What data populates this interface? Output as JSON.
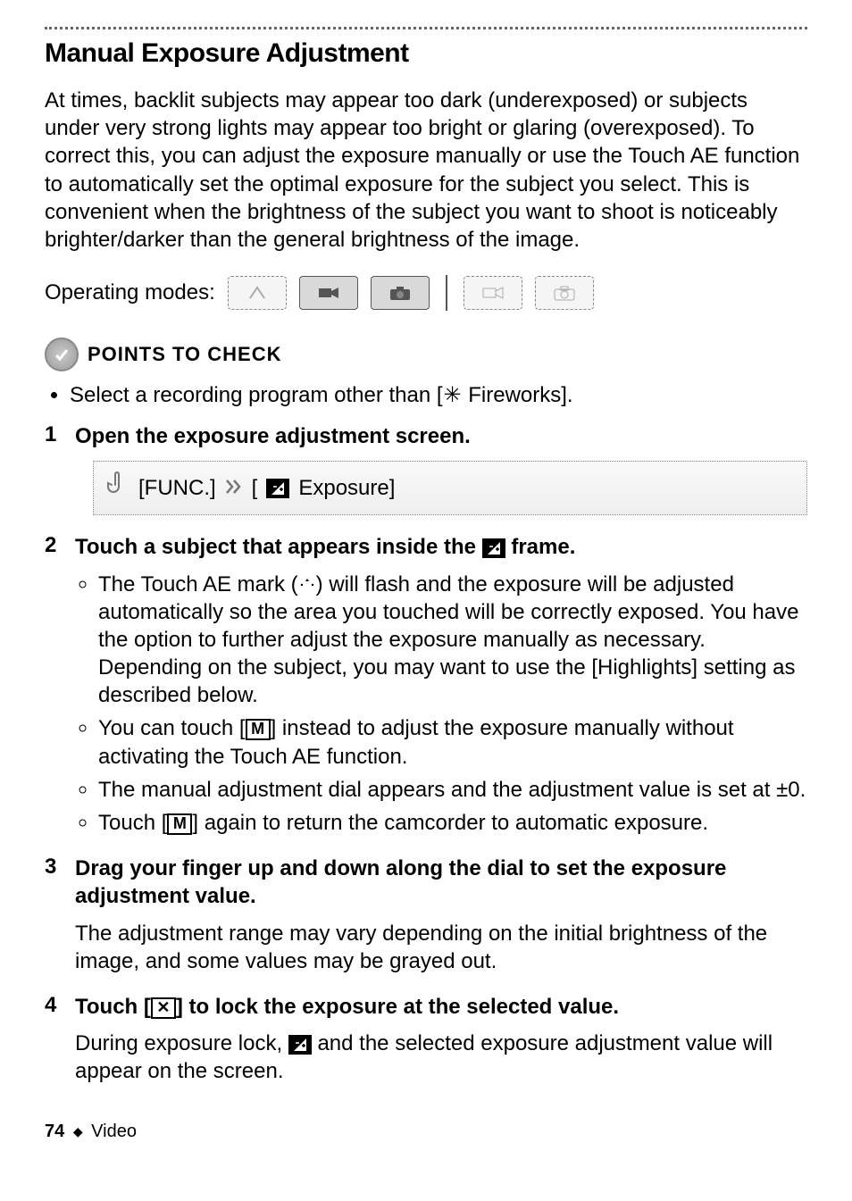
{
  "title": "Manual Exposure Adjustment",
  "intro": "At times, backlit subjects may appear too dark (underexposed) or subjects under very strong lights may appear too bright or glaring (overexposed). To correct this, you can adjust the exposure manually or use the Touch AE function to automatically set the optimal exposure for the subject you select. This is convenient when the brightness of the subject you want to shoot is noticeably brighter/darker than the general brightness of the image.",
  "operating_modes_label": "Operating modes:",
  "points_to_check_label": "POINTS TO CHECK",
  "check_item_prefix": "Select a recording program other than [",
  "check_item_suffix": " Fireworks].",
  "steps": {
    "s1": {
      "title": "Open the exposure adjustment screen."
    },
    "s2": {
      "title_a": "Touch a subject that appears inside the ",
      "title_b": " frame.",
      "b1": "The Touch AE mark (",
      "b1b": ") will flash and the exposure will be adjusted automatically so the area you touched will be correctly exposed. You have the option to further adjust the exposure manually as necessary. Depending on the subject, you may want to use the [Highlights] setting as described below.",
      "b2a": "You can touch [",
      "b2b": "] instead to adjust the exposure manually without activating the Touch AE function.",
      "b3": "The manual adjustment dial appears and the adjustment value is set at ±0.",
      "b4a": "Touch [",
      "b4b": "] again to return the camcorder to automatic exposure."
    },
    "s3": {
      "title": "Drag your finger up and down along the dial to set the exposure adjustment value.",
      "body": "The adjustment range may vary depending on the initial brightness of the image, and some values may be grayed out."
    },
    "s4": {
      "title_a": "Touch [",
      "title_b": "] to lock the exposure at the selected value.",
      "body_a": "During exposure lock, ",
      "body_b": " and the selected exposure adjustment value will appear on the screen."
    }
  },
  "func": {
    "label_func": "[FUNC.]",
    "label_exposure": " Exposure]"
  },
  "icons": {
    "M": "M",
    "X": "✕",
    "ae_mark": "⁝⁚⁝"
  },
  "footer": {
    "page_number": "74",
    "section": "Video"
  }
}
